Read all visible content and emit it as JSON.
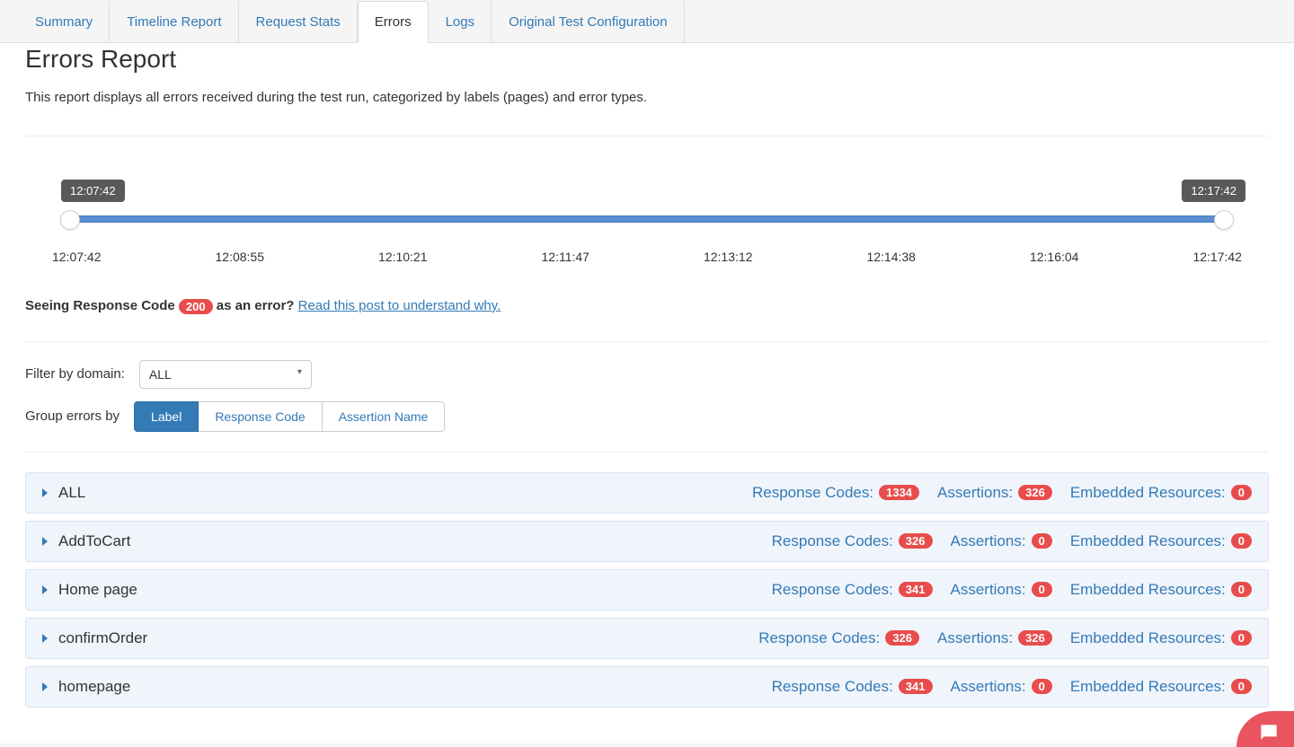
{
  "tabs": [
    {
      "label": "Summary",
      "active": false
    },
    {
      "label": "Timeline Report",
      "active": false
    },
    {
      "label": "Request Stats",
      "active": false
    },
    {
      "label": "Errors",
      "active": true
    },
    {
      "label": "Logs",
      "active": false
    },
    {
      "label": "Original Test Configuration",
      "active": false
    }
  ],
  "page": {
    "title": "Errors Report",
    "description": "This report displays all errors received during the test run, categorized by labels (pages) and error types."
  },
  "slider": {
    "start_label": "12:07:42",
    "end_label": "12:17:42",
    "ticks": [
      "12:07:42",
      "12:08:55",
      "12:10:21",
      "12:11:47",
      "12:13:12",
      "12:14:38",
      "12:16:04",
      "12:17:42"
    ]
  },
  "note": {
    "prefix": "Seeing Response Code ",
    "code": "200",
    "suffix": " as an error? ",
    "link": "Read this post to understand why."
  },
  "filters": {
    "domain_label": "Filter by domain:",
    "domain_value": "ALL",
    "group_label": "Group errors by",
    "group_options": [
      "Label",
      "Response Code",
      "Assertion Name"
    ],
    "group_selected": "Label"
  },
  "stat_labels": {
    "response_codes": "Response Codes:",
    "assertions": "Assertions:",
    "embedded": "Embedded Resources:"
  },
  "rows": [
    {
      "label": "ALL",
      "response_codes": "1334",
      "assertions": "326",
      "embedded": "0"
    },
    {
      "label": "AddToCart",
      "response_codes": "326",
      "assertions": "0",
      "embedded": "0"
    },
    {
      "label": "Home page",
      "response_codes": "341",
      "assertions": "0",
      "embedded": "0"
    },
    {
      "label": "confirmOrder",
      "response_codes": "326",
      "assertions": "326",
      "embedded": "0"
    },
    {
      "label": "homepage",
      "response_codes": "341",
      "assertions": "0",
      "embedded": "0"
    }
  ]
}
